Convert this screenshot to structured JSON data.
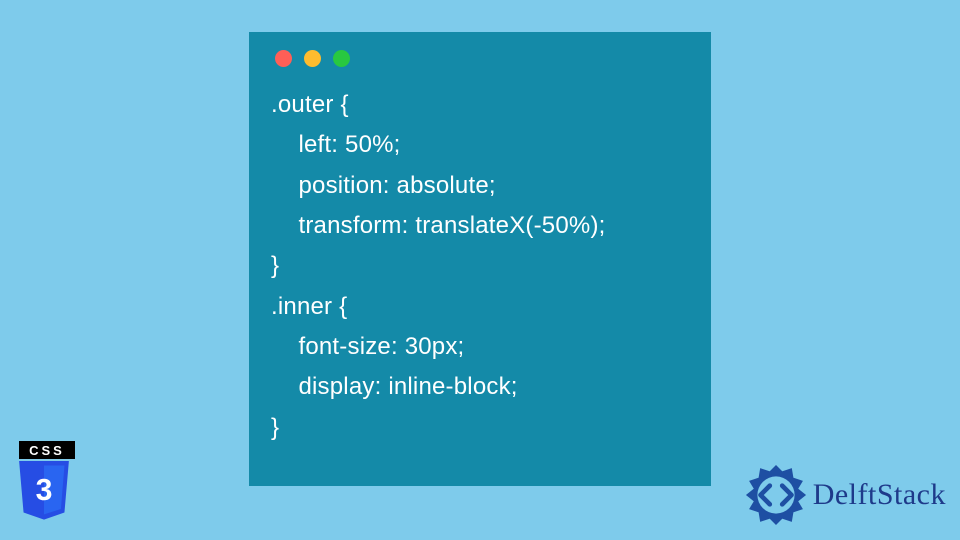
{
  "code_block": {
    "lines": [
      ".outer {",
      "    left: 50%;",
      "    position: absolute;",
      "    transform: translateX(-50%);",
      "}",
      ".inner {",
      "    font-size: 30px;",
      "    display: inline-block;",
      "}"
    ]
  },
  "badge": {
    "top_label": "CSS",
    "number": "3"
  },
  "brand": {
    "name": "DelftStack"
  }
}
